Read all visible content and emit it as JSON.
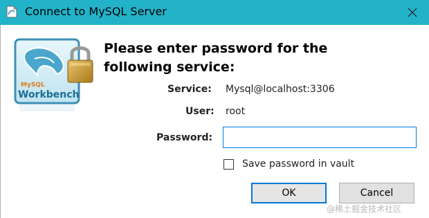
{
  "window": {
    "title": "Connect to MySQL Server",
    "accent_color": "#22b3c9"
  },
  "icons": {
    "app": "mysql-workbench-app-icon",
    "close": "close-icon",
    "logo": "mysql-workbench-logo",
    "lock": "padlock-icon"
  },
  "logo": {
    "line1": "MySQL",
    "line2": "Workbench"
  },
  "heading": {
    "line1": "Please enter password for the",
    "line2": "following service:"
  },
  "fields": {
    "service_label": "Service:",
    "service_value": "Mysql@localhost:3306",
    "user_label": "User:",
    "user_value": "root",
    "password_label": "Password:",
    "password_value": ""
  },
  "save_password": {
    "label": "Save password in vault",
    "checked": false
  },
  "buttons": {
    "ok": "OK",
    "cancel": "Cancel"
  },
  "watermark": "@稀土掘金技术社区"
}
